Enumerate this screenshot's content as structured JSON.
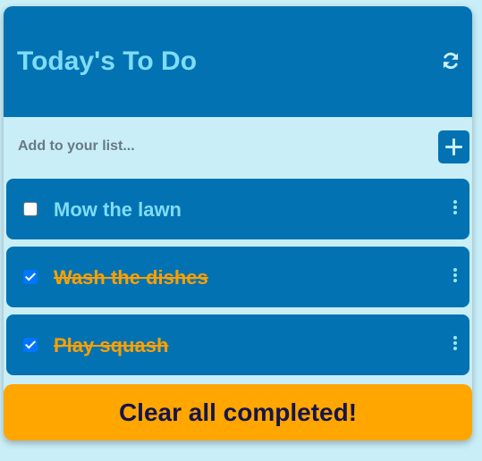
{
  "header": {
    "title": "Today's To Do",
    "refresh_icon": "refresh-icon"
  },
  "add": {
    "placeholder": "Add to your list...",
    "value": "",
    "button_icon": "plus-icon"
  },
  "items": [
    {
      "label": "Mow the lawn",
      "completed": false
    },
    {
      "label": "Wash the dishes",
      "completed": true
    },
    {
      "label": "Play squash",
      "completed": true
    }
  ],
  "footer": {
    "clear_label": "Clear all completed!"
  },
  "colors": {
    "page_bg": "#c9eef8",
    "header_bg": "#0272b3",
    "title_text": "#7fdcf5",
    "completed_text": "#f9a004",
    "clear_button_bg": "#ffa600",
    "clear_button_text": "#16154a"
  }
}
